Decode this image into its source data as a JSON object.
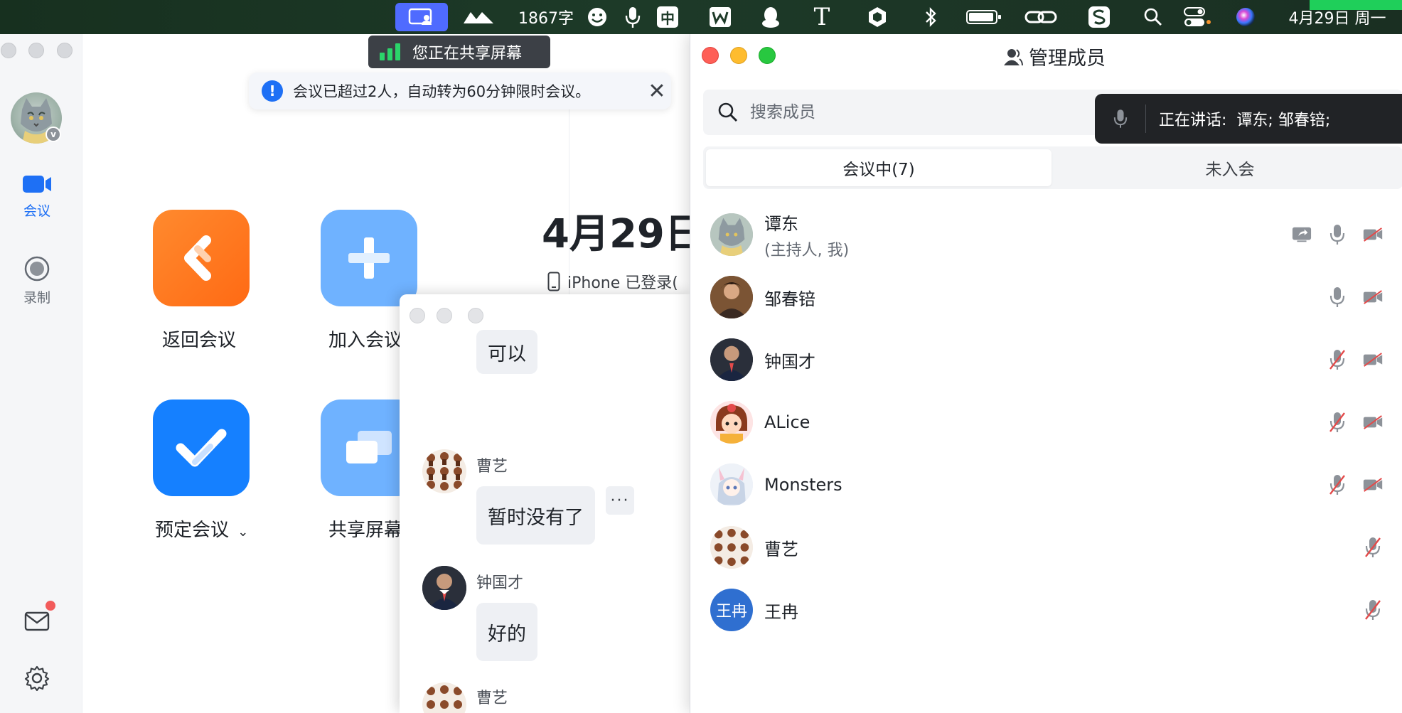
{
  "menubar": {
    "word_count": "1867字",
    "ime": "中",
    "datetime": "4月29日 周一"
  },
  "share_banner": {
    "text": "您正在共享屏幕"
  },
  "notice": {
    "text": "会议已超过2人，自动转为60分钟限时会议。"
  },
  "sidebar": {
    "items": [
      {
        "label": "会议",
        "icon": "video-camera-icon",
        "active": true
      },
      {
        "label": "录制",
        "icon": "record-icon",
        "active": false
      }
    ]
  },
  "home": {
    "tiles": [
      {
        "label": "返回会议",
        "color": "#ff7a22",
        "icon": "back-arrow-icon"
      },
      {
        "label": "加入会议",
        "color": "#6fb2ff",
        "icon": "plus-icon"
      },
      {
        "label": "预定会议",
        "color": "#1580ff",
        "icon": "check-icon"
      },
      {
        "label": "共享屏幕",
        "color": "#6fb2ff",
        "icon": "share-screen-icon"
      }
    ],
    "date": "4月29日",
    "device_status": "iPhone 已登录("
  },
  "chat": {
    "messages": [
      {
        "sender": "",
        "text": "可以"
      },
      {
        "sender": "曹艺",
        "text": "暂时没有了"
      },
      {
        "sender": "钟国才",
        "text": "好的"
      },
      {
        "sender": "曹艺",
        "text": ""
      }
    ],
    "more_label": "···"
  },
  "members": {
    "title": "管理成员",
    "search_placeholder": "搜索成员",
    "tabs": [
      {
        "label": "会议中(7)",
        "active": true
      },
      {
        "label": "未入会",
        "active": false
      }
    ],
    "list": [
      {
        "name": "谭东",
        "role": "(主持人, 我)",
        "mic": "on",
        "video": "off",
        "sharing": true
      },
      {
        "name": "邹春锫",
        "role": "",
        "mic": "on",
        "video": "off",
        "sharing": false
      },
      {
        "name": "钟国才",
        "role": "",
        "mic": "off",
        "video": "off",
        "sharing": false
      },
      {
        "name": "ALice",
        "role": "",
        "mic": "off",
        "video": "off",
        "sharing": false
      },
      {
        "name": "Monsters",
        "role": "",
        "mic": "off",
        "video": "off",
        "sharing": false
      },
      {
        "name": "曹艺",
        "role": "",
        "mic": "off",
        "video": "none",
        "sharing": false
      },
      {
        "name": "王冉",
        "role": "",
        "mic": "off",
        "video": "none",
        "sharing": false,
        "avatar_text": "王冉"
      }
    ]
  },
  "speaking": {
    "label": "正在讲话:",
    "names": "谭东; 邹春锫;"
  }
}
